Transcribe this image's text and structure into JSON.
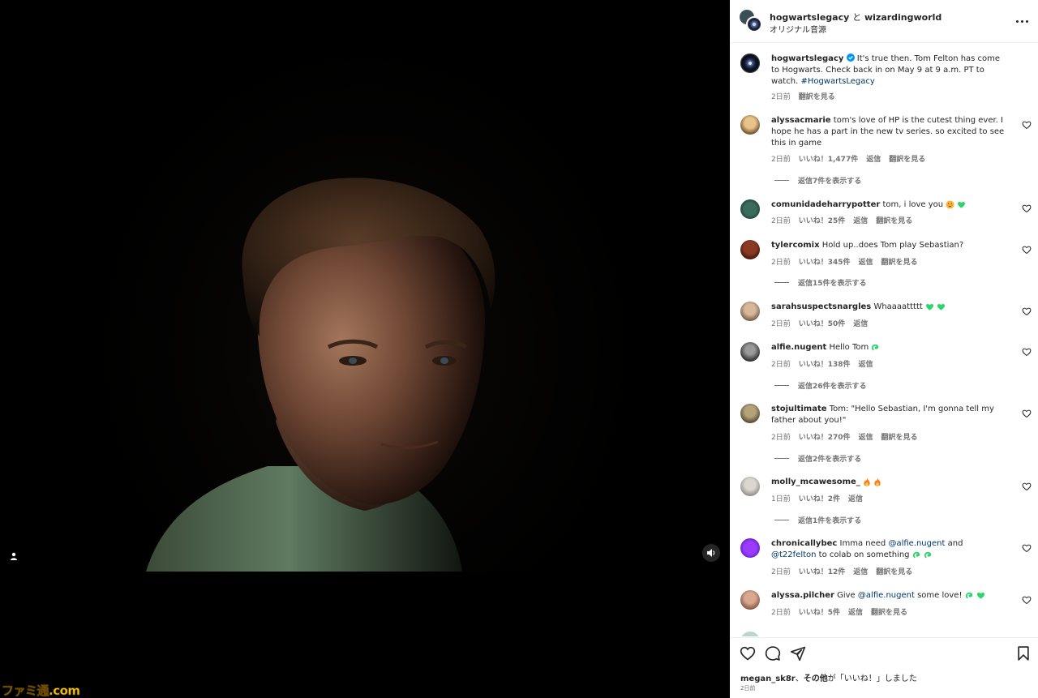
{
  "header": {
    "user1": "hogwartslegacy",
    "conjunction": "と",
    "user2": "wizardingworld",
    "audio": "オリジナル音源"
  },
  "caption": {
    "username": "hogwartslegacy",
    "text": "It's true then. Tom Felton has come to Hogwarts. Check back in on May 9 at 9 a.m. PT to watch.",
    "hashtag": "#HogwartsLegacy",
    "time": "2日前",
    "translate": "翻訳を見る"
  },
  "comments": [
    {
      "username": "alyssacmarie",
      "text": "tom's love of HP is the cutest thing ever. I hope he has a part in the new tv series. so excited to see this in game",
      "time": "2日前",
      "likes": "いいね！1,477件",
      "reply": "返信",
      "translate": "翻訳を見る",
      "replies": "返信7件を表示する"
    },
    {
      "username": "comunidadeharrypotter",
      "text": "tom, i love you",
      "time": "2日前",
      "likes": "いいね！25件",
      "reply": "返信",
      "translate": "翻訳を見る"
    },
    {
      "username": "tylercomix",
      "text": "Hold up..does Tom play Sebastian?",
      "time": "2日前",
      "likes": "いいね！345件",
      "reply": "返信",
      "translate": "翻訳を見る",
      "replies": "返信15件を表示する"
    },
    {
      "username": "sarahsuspectsnargles",
      "text": "Whaaaattttt",
      "time": "2日前",
      "likes": "いいね！50件",
      "reply": "返信"
    },
    {
      "username": "alfie.nugent",
      "text": "Hello Tom",
      "time": "2日前",
      "likes": "いいね！138件",
      "reply": "返信",
      "replies": "返信26件を表示する"
    },
    {
      "username": "stojultimate",
      "text": "Tom: \"Hello Sebastian, I'm gonna tell my father about you!\"",
      "time": "2日前",
      "likes": "いいね！270件",
      "reply": "返信",
      "translate": "翻訳を見る",
      "replies": "返信2件を表示する"
    },
    {
      "username": "molly_mcawesome_",
      "text": "",
      "time": "1日前",
      "likes": "いいね！2件",
      "reply": "返信",
      "replies": "返信1件を表示する"
    },
    {
      "username": "chronicallybec",
      "text_a": "Imma need",
      "mention_a": "@alfie.nugent",
      "text_b": "and",
      "mention_b": "@t22felton",
      "text_c": "to colab on something",
      "time": "2日前",
      "likes": "いいね！12件",
      "reply": "返信",
      "translate": "翻訳を見る"
    },
    {
      "username": "alyssa.pilcher",
      "text_a": "Give",
      "mention_a": "@alfie.nugent",
      "text_b": "some love!",
      "time": "2日前",
      "likes": "いいね！5件",
      "reply": "返信",
      "translate": "翻訳を見る"
    }
  ],
  "footer": {
    "liked_by_user": "megan_sk8r",
    "liked_by_sep": "、",
    "liked_by_others": "その他",
    "liked_by_suffix": "が「いいね！」しました",
    "date": "2日前"
  },
  "watermark": "ファミ通.com",
  "colors": {
    "verified": "#0095f6",
    "green_heart": "#2dd46a",
    "mention": "#00376b",
    "secondary_text": "#737373"
  },
  "icons": [
    "heart-icon",
    "comment-icon",
    "share-icon",
    "bookmark-icon",
    "more-icon",
    "sound-icon",
    "user-tag-icon",
    "verified-icon"
  ]
}
